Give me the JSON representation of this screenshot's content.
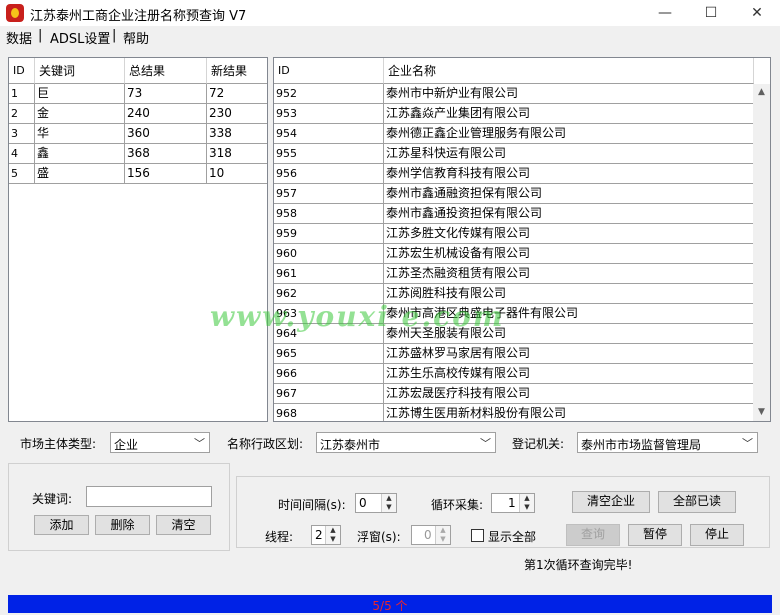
{
  "window": {
    "title": "江苏泰州工商企业注册名称预查询 V7",
    "minimize": "—",
    "maximize": "☐",
    "close": "✕"
  },
  "menu": {
    "items": [
      "数据",
      "|",
      "ADSL设置",
      "|",
      "帮助"
    ]
  },
  "keywords_table": {
    "columns": [
      "ID",
      "关键词",
      "总结果",
      "新结果"
    ],
    "rows": [
      [
        "1",
        "巨",
        "73",
        "72"
      ],
      [
        "2",
        "金",
        "240",
        "230"
      ],
      [
        "3",
        "华",
        "360",
        "338"
      ],
      [
        "4",
        "鑫",
        "368",
        "318"
      ],
      [
        "5",
        "盛",
        "156",
        "10"
      ]
    ]
  },
  "company_table": {
    "columns": [
      "ID",
      "企业名称"
    ],
    "rows": [
      [
        "952",
        "泰州市中新炉业有限公司"
      ],
      [
        "953",
        "江苏鑫焱产业集团有限公司"
      ],
      [
        "954",
        "泰州德正鑫企业管理服务有限公司"
      ],
      [
        "955",
        "江苏星科快运有限公司"
      ],
      [
        "956",
        "泰州学信教育科技有限公司"
      ],
      [
        "957",
        "泰州市鑫通融资担保有限公司"
      ],
      [
        "958",
        "泰州市鑫通投资担保有限公司"
      ],
      [
        "959",
        "江苏多胜文化传媒有限公司"
      ],
      [
        "960",
        "江苏宏生机械设备有限公司"
      ],
      [
        "961",
        "江苏圣杰融资租赁有限公司"
      ],
      [
        "962",
        "江苏阅胜科技有限公司"
      ],
      [
        "963",
        "泰州市高港区典盛电子器件有限公司"
      ],
      [
        "964",
        "泰州天圣服装有限公司"
      ],
      [
        "965",
        "江苏盛林罗马家居有限公司"
      ],
      [
        "966",
        "江苏生乐高校传媒有限公司"
      ],
      [
        "967",
        "江苏宏晟医疗科技有限公司"
      ],
      [
        "968",
        "江苏博生医用新材料股份有限公司"
      ]
    ]
  },
  "watermark": "www.youxi    e.com",
  "filters": {
    "entity_type_label": "市场主体类型:",
    "entity_type_value": "企业",
    "region_label": "名称行政区划:",
    "region_value": "江苏泰州市",
    "authority_label": "登记机关:",
    "authority_value": "泰州市市场监督管理局"
  },
  "keyword_panel": {
    "label": "关键词:",
    "input_value": "",
    "add": "添加",
    "delete": "删除",
    "clear": "清空"
  },
  "control_panel": {
    "interval_label": "时间间隔(s):",
    "interval_value": "0",
    "loop_label": "循环采集:",
    "loop_value": "1",
    "threads_label": "线程:",
    "threads_value": "2",
    "float_label": "浮窗(s):",
    "float_value": "0",
    "show_all_label": "显示全部",
    "clear_company": "清空企业",
    "mark_all_read": "全部已读",
    "query": "查询",
    "pause": "暂停",
    "stop": "停止",
    "status": "第1次循环查询完毕!"
  },
  "progress": {
    "text": "5/5 个",
    "fraction": 1.0
  }
}
